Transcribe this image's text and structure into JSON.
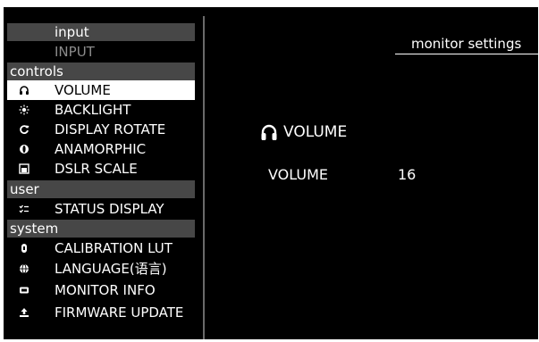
{
  "header": {
    "title": "monitor settings"
  },
  "menu": {
    "input_section": "input",
    "input_value": "INPUT",
    "controls_section": "controls",
    "controls": [
      {
        "label": "VOLUME",
        "icon": "headphones-icon",
        "selected": true
      },
      {
        "label": "BACKLIGHT",
        "icon": "sun-icon"
      },
      {
        "label": "DISPLAY ROTATE",
        "icon": "rotate-icon"
      },
      {
        "label": "ANAMORPHIC",
        "icon": "anamorphic-icon"
      },
      {
        "label": "DSLR SCALE",
        "icon": "scale-icon"
      }
    ],
    "user_section": "user",
    "user": [
      {
        "label": "STATUS DISPLAY",
        "icon": "status-icon"
      }
    ],
    "system_section": "system",
    "system": [
      {
        "label": "CALIBRATION LUT",
        "icon": "lut-icon"
      },
      {
        "label": "LANGUAGE(语言)",
        "icon": "globe-icon"
      },
      {
        "label": "MONITOR INFO",
        "icon": "monitor-icon"
      },
      {
        "label": "FIRMWARE UPDATE",
        "icon": "upload-icon"
      }
    ],
    "more_icon": "chevron-down-icon"
  },
  "panel": {
    "heading": "VOLUME",
    "param_label": "VOLUME",
    "param_value": "16"
  },
  "colors": {
    "background": "#000000",
    "section_bar": "#474747",
    "selected_bg": "#ffffff",
    "selected_text": "#000000",
    "subdued_text": "#8c8c8c"
  }
}
